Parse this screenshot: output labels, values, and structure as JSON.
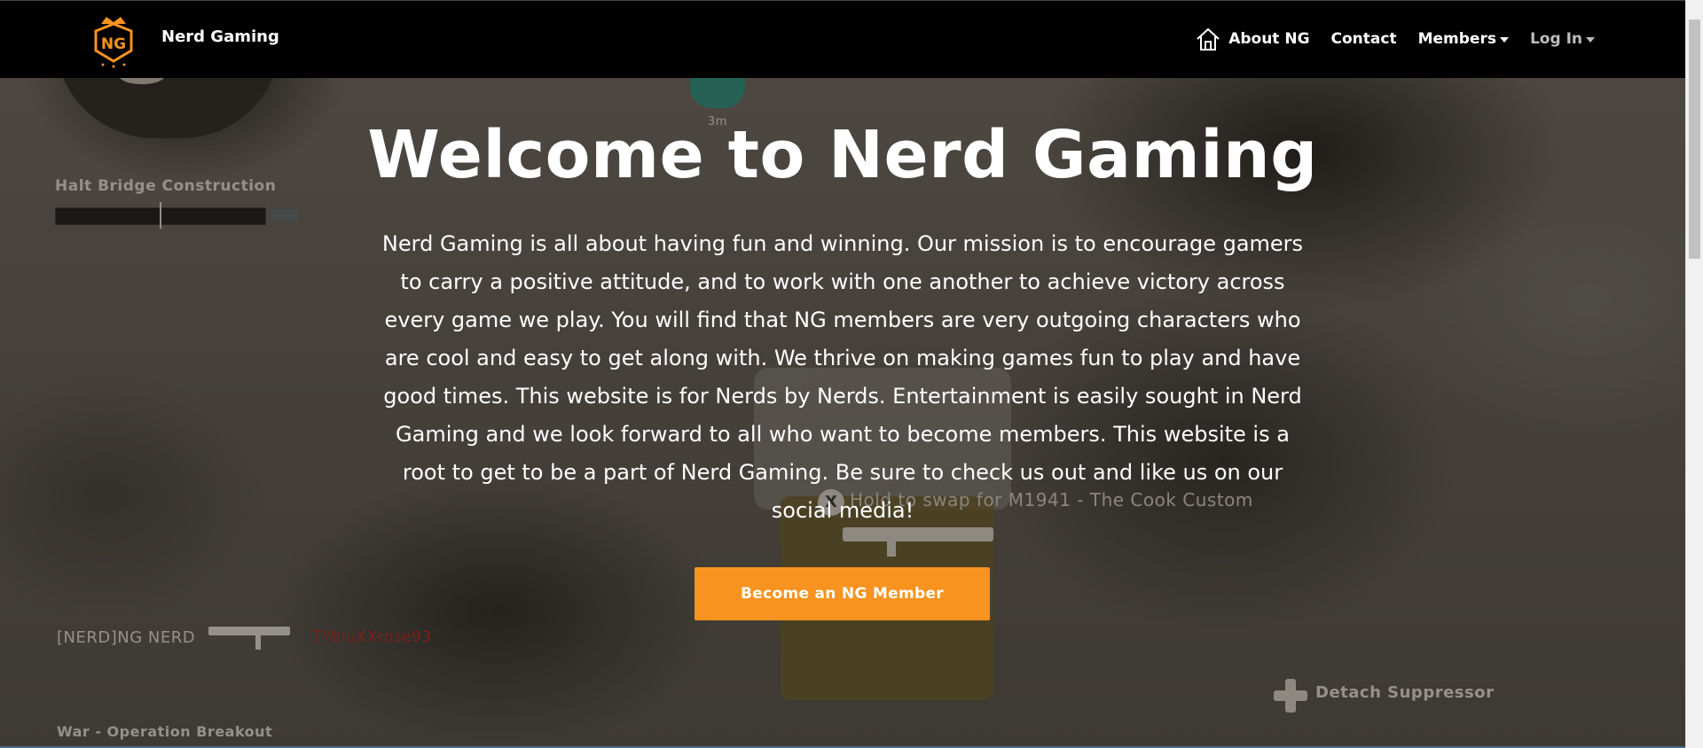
{
  "navbar": {
    "brand": "Nerd Gaming",
    "logo_text": "NG",
    "links": {
      "about": "About NG",
      "contact": "Contact",
      "members": "Members",
      "login": "Log In"
    }
  },
  "hero": {
    "title": "Welcome to Nerd Gaming",
    "description": "Nerd Gaming is all about having fun and winning. Our mission is to encourage gamers to carry a positive attitude, and to work with one another to achieve victory across every game we play. You will find that NG members are very outgoing characters who are cool and easy to get along with. We thrive on making games fun to play and have good times. This website is for Nerds by Nerds. Entertainment is easily sought in Nerd Gaming and we look forward to all who want to become members. This website is a root to get to be a part of Nerd Gaming. Be sure to check us out and like us on our social media!",
    "cta_label": "Become an NG Member"
  },
  "background_hud": {
    "objective": "Halt Bridge Construction",
    "marker_distance": "3m",
    "killfeed_player": "[NERD]NG NERD",
    "killfeed_victim": "TYbluXXrose93",
    "swap_key": "X",
    "swap_prompt": "Hold to swap for M1941 - The Cook  Custom",
    "suppressor_prompt": "Detach Suppressor",
    "mode": "War - Operation Breakout"
  },
  "colors": {
    "navbar_bg": "#000000",
    "accent": "#f7931e",
    "text": "#ffffff",
    "muted_link": "#bdbdbd"
  },
  "icons": {
    "home": "home-icon",
    "logo": "ng-crown-shield-logo",
    "caret": "caret-down-icon"
  }
}
